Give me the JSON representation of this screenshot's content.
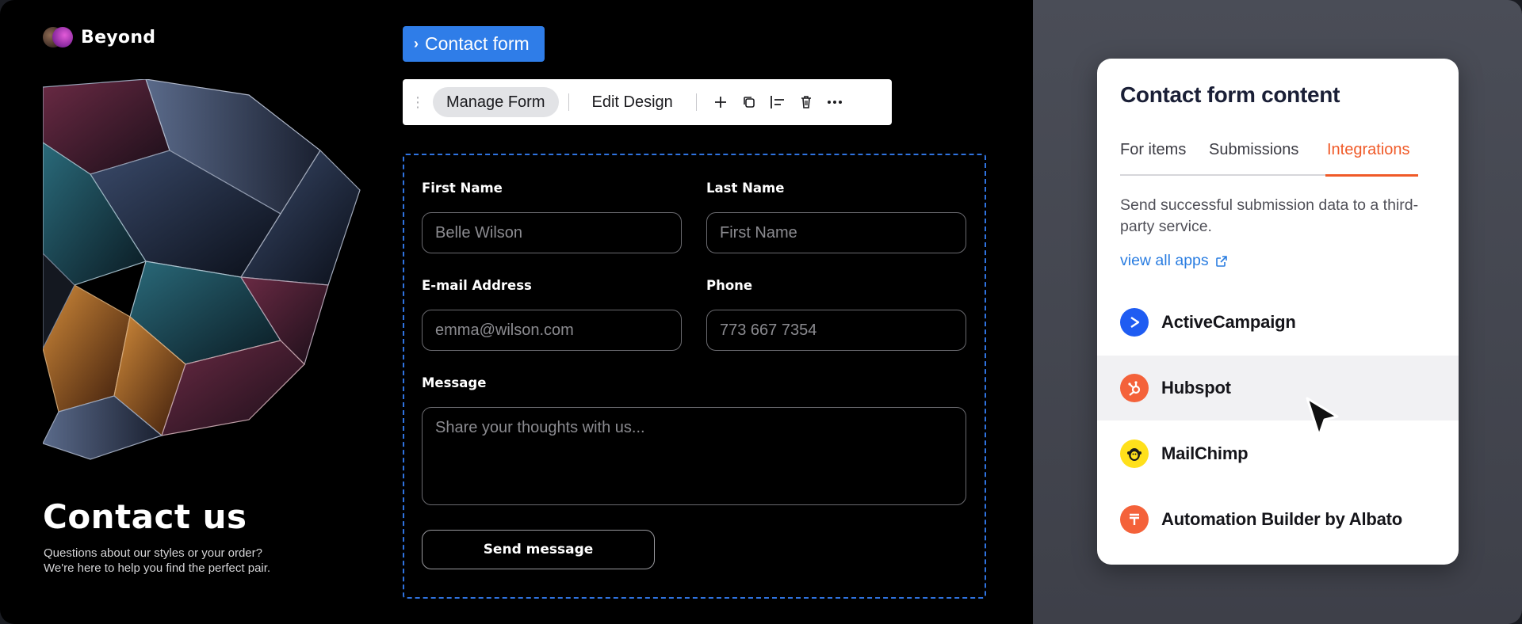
{
  "brand": {
    "name": "Beyond"
  },
  "hero": {
    "title": "Contact us",
    "subtitle_line1": "Questions about our styles or your order?",
    "subtitle_line2": "We're here to help you find the perfect pair."
  },
  "breadcrumb": {
    "label": "Contact form"
  },
  "toolbar": {
    "manage_label": "Manage Form",
    "design_label": "Edit Design",
    "icons": [
      "drag-handle-icon",
      "plus-icon",
      "duplicate-icon",
      "align-left-icon",
      "trash-icon",
      "more-icon"
    ]
  },
  "form": {
    "first_name": {
      "label": "First Name",
      "placeholder": "Belle Wilson"
    },
    "last_name": {
      "label": "Last Name",
      "placeholder": "First Name"
    },
    "email": {
      "label": "E-mail Address",
      "placeholder": "emma@wilson.com"
    },
    "phone": {
      "label": "Phone",
      "placeholder": "773 667 7354"
    },
    "message": {
      "label": "Message",
      "placeholder": "Share your thoughts with us..."
    },
    "submit_label": "Send message"
  },
  "panel": {
    "title": "Contact form content",
    "tabs": [
      {
        "label": "For items",
        "active": false
      },
      {
        "label": "Submissions",
        "active": false
      },
      {
        "label": "Integrations",
        "active": true
      }
    ],
    "description": "Send successful submission data to a third-party service.",
    "link_label": "view all apps",
    "apps": [
      {
        "name": "ActiveCampaign",
        "color": "#1f5cf2",
        "icon": "activecampaign-icon"
      },
      {
        "name": "Hubspot",
        "color": "#f4623a",
        "icon": "hubspot-icon"
      },
      {
        "name": "MailChimp",
        "color": "#ffe01b",
        "icon": "mailchimp-icon"
      },
      {
        "name": "Automation Builder by Albato",
        "color": "#f4623a",
        "icon": "albato-icon"
      }
    ]
  },
  "colors": {
    "accent_blue": "#2f7de8",
    "accent_orange": "#f05a28",
    "form_dashed_border": "#2f73e0"
  }
}
